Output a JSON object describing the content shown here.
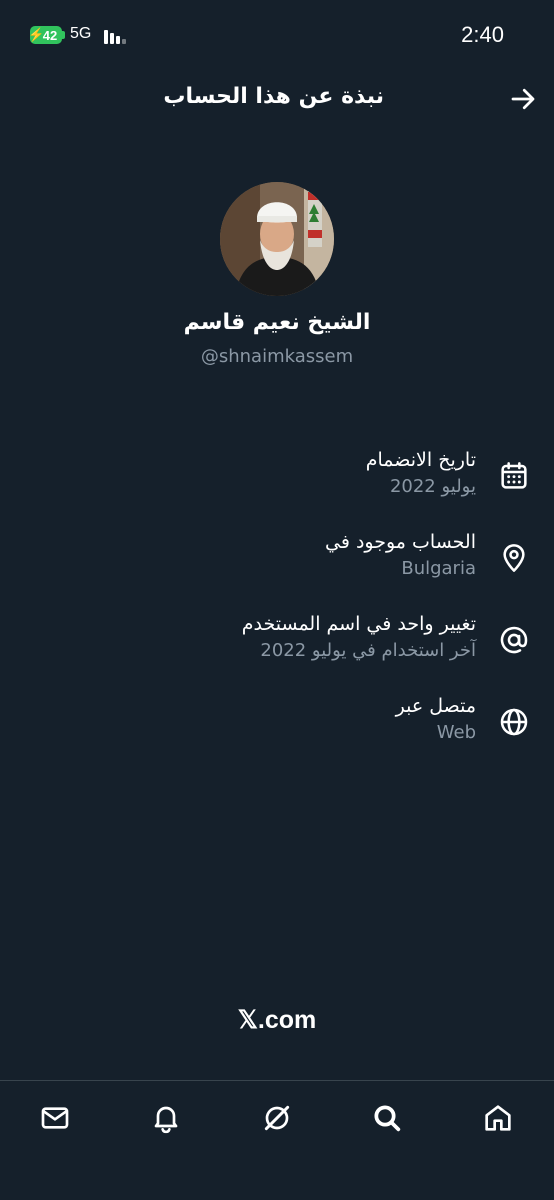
{
  "status_bar": {
    "battery": "42",
    "network": "5G",
    "time": "2:40"
  },
  "header": {
    "title": "نبذة عن هذا الحساب",
    "back_icon": "arrow-right-icon"
  },
  "profile": {
    "display_name": "الشيخ نعيم قاسم",
    "handle": "@shnaimkassem",
    "avatar_icon": "profile-photo"
  },
  "info": [
    {
      "icon": "calendar-icon",
      "label": "تاريخ الانضمام",
      "value": "يوليو 2022"
    },
    {
      "icon": "location-pin-icon",
      "label": "الحساب موجود في",
      "value": "Bulgaria"
    },
    {
      "icon": "at-sign-icon",
      "label": "تغيير واحد في اسم المستخدم",
      "value": "آخر استخدام في يوليو 2022"
    },
    {
      "icon": "globe-icon",
      "label": "متصل عبر",
      "value": "Web"
    }
  ],
  "footer": {
    "brand": "𝕏.com"
  },
  "tab_bar": {
    "items": [
      "mail-icon",
      "bell-icon",
      "grok-icon",
      "search-icon",
      "home-icon"
    ]
  },
  "colors": {
    "background": "#15202b",
    "secondary_text": "#8b98a5",
    "battery": "#31c35d"
  }
}
